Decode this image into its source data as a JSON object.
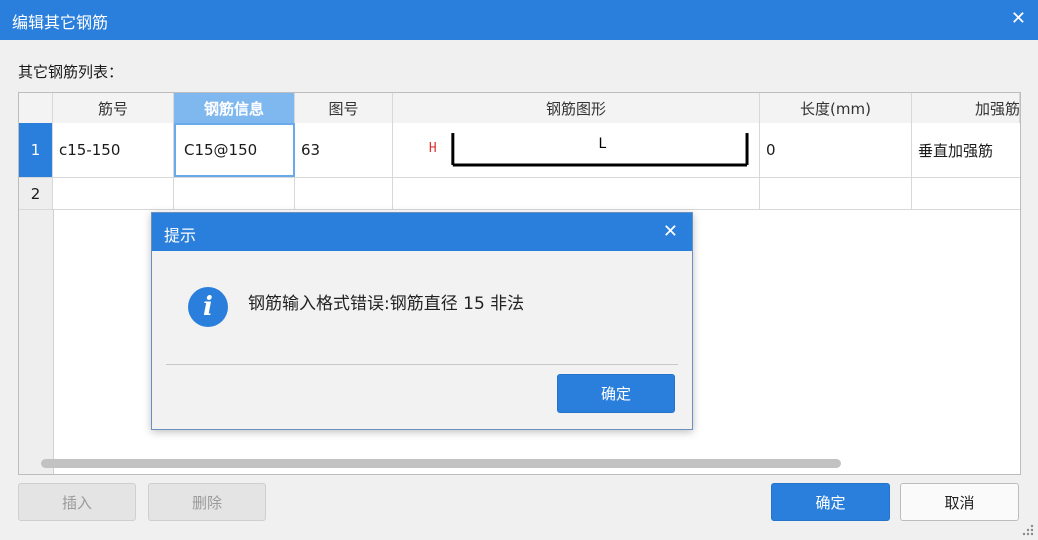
{
  "window": {
    "title": "编辑其它钢筋",
    "close_glyph": "✕"
  },
  "list_label": "其它钢筋列表：",
  "table": {
    "headers": [
      "筋号",
      "钢筋信息",
      "图号",
      "钢筋图形",
      "长度(mm)",
      "加强筋类"
    ],
    "rows": [
      {
        "num": "1",
        "bar_no": "c15-150",
        "info": "C15@150",
        "fig_no": "63",
        "shape_h": "H",
        "shape_l": "L",
        "length": "0",
        "type": "垂直加强筋"
      },
      {
        "num": "2",
        "bar_no": "",
        "info": "",
        "fig_no": "",
        "shape_h": "",
        "shape_l": "",
        "length": "",
        "type": ""
      }
    ]
  },
  "buttons": {
    "insert": "插入",
    "delete": "删除",
    "ok": "确定",
    "cancel": "取消"
  },
  "dialog": {
    "title": "提示",
    "close_glyph": "✕",
    "icon": "info-icon",
    "icon_glyph": "i",
    "message": "钢筋输入格式错误:钢筋直径 15 非法",
    "ok": "确定"
  },
  "colors": {
    "accent": "#2b7fdc",
    "header_active": "#7fb8ef",
    "shape_h": "#e03030"
  }
}
